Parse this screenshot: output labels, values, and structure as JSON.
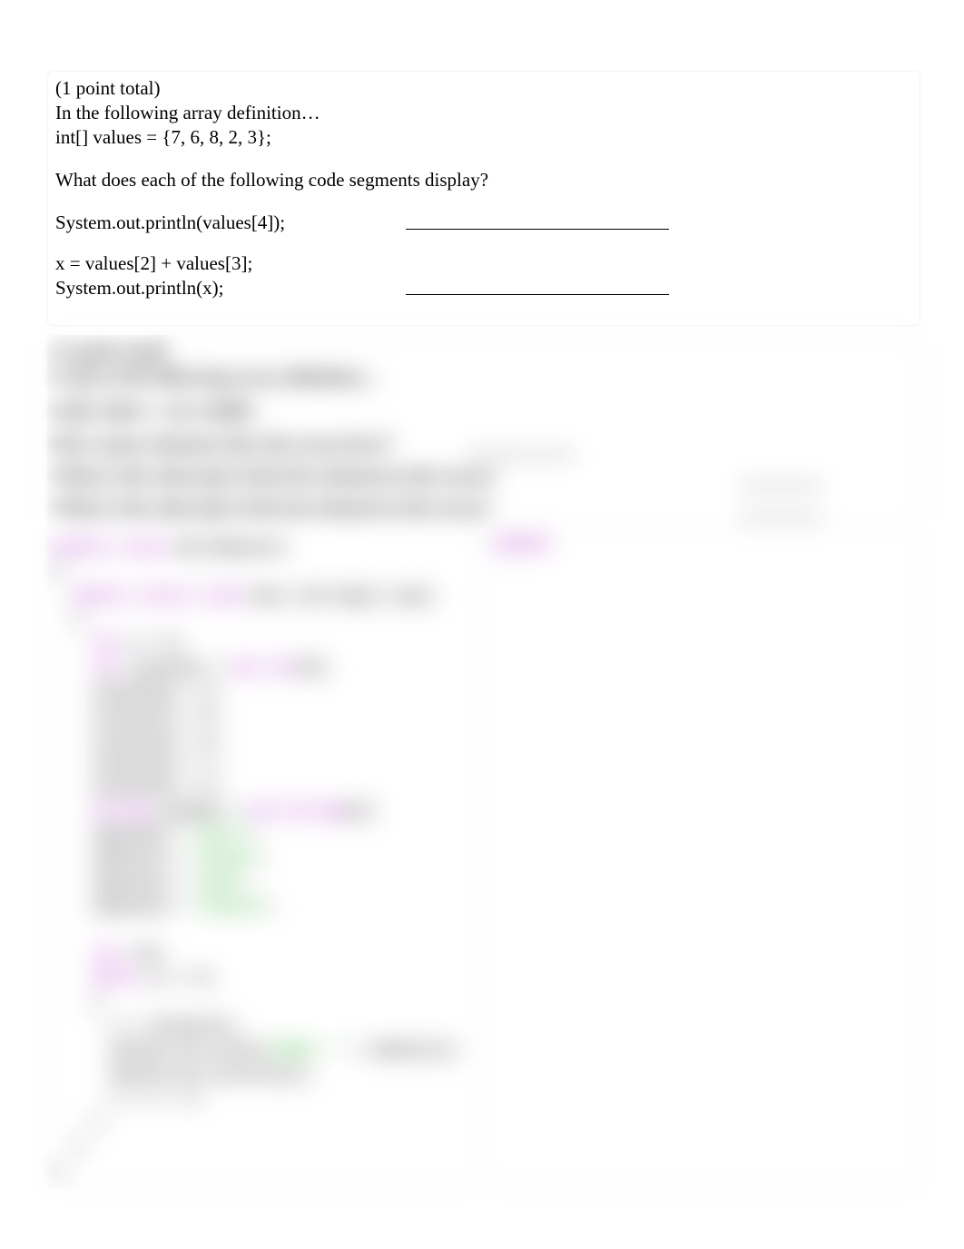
{
  "q1": {
    "points": "(1 point total)",
    "intro": "In the following array definition…",
    "decl": "int[] values = {7, 6, 8, 2, 3};",
    "prompt": "What does each of the following code segments display?",
    "line1": "System.out.println(values[4]);",
    "line2a": "x = values[2] + values[3];",
    "line2b": "System.out.println(x);"
  },
  "q2": {
    "points": "(1 point total)",
    "intro": "Look at the following array definition…",
    "decl": "int[] values = new int[8];",
    "p1": "How many elements does the array have?",
    "p2": "What is the subscript of the first element in the array?",
    "p3": "What is the subscript of the last element in the array?"
  },
  "code": {
    "header_kw": "public class",
    "header_name": " WorthXpoints",
    "main_kw": "public static void",
    "main_sig": " main (String[] args)",
    "brace_o": "{",
    "brace_c": "}",
    "int_kw": "int",
    "decl_x": " x = 0;",
    "arr_kw": "int",
    "arr_decl": " []values = ",
    "new_kw": "new int",
    "arr_sz": "[5];",
    "v0": "values[0] = 3;",
    "v1": "values[1] = 5;",
    "v2": "values[2] = 9;",
    "v3": "values[3] = 7;",
    "v4": "values[4] = 2;",
    "str_kw": "String",
    "str_decl": " []names = ",
    "new_str": "new String",
    "str_sz": "[4];",
    "n0a": "names[0] = ",
    "n0b": "\"Bill\"",
    "n0c": ";",
    "n1a": "names[1] = ",
    "n1b": "\"Susan\"",
    "n1c": ";",
    "n2a": "names[2] = ",
    "n2b": "\"Sam\"",
    "n2c": ";",
    "n3a": "names[3] = ",
    "n3b": "\"Connie\"",
    "n3c": ";",
    "ix_kw": "int",
    "ix_decl": " i=0;",
    "while_kw": "while",
    "while_cond": " (i < 4)",
    "body1": "x = values[i];",
    "body2a": "System.out.print(",
    "body2b": "\"Name: \"",
    "body2c": " + names[i]);",
    "body3": "System.out.println(x);",
    "body4": "i = i + 1;"
  },
  "output_label": "OUTPUT"
}
